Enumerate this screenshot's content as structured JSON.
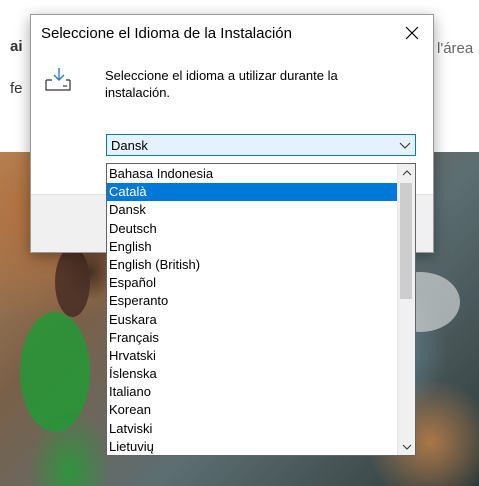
{
  "background": {
    "text_left_1": "ai",
    "text_left_2": "fe",
    "text_right": "l'área"
  },
  "dialog": {
    "title": "Seleccione el Idioma de la Instalación",
    "prompt": "Seleccione el idioma a utilizar durante la instalación.",
    "combo_value": "Dansk",
    "icons": {
      "close": "close-icon",
      "install": "install-download-icon",
      "combo_arrow": "chevron-down-icon"
    },
    "options": [
      "Bahasa Indonesia",
      "Català",
      "Dansk",
      "Deutsch",
      "English",
      "English (British)",
      "Español",
      "Esperanto",
      "Euskara",
      "Français",
      "Hrvatski",
      "Íslenska",
      "Italiano",
      "Korean",
      "Latviski",
      "Lietuvių"
    ],
    "highlighted_option": "Català"
  },
  "colors": {
    "accent": "#0078d7",
    "highlight_text": "#ffffff"
  }
}
